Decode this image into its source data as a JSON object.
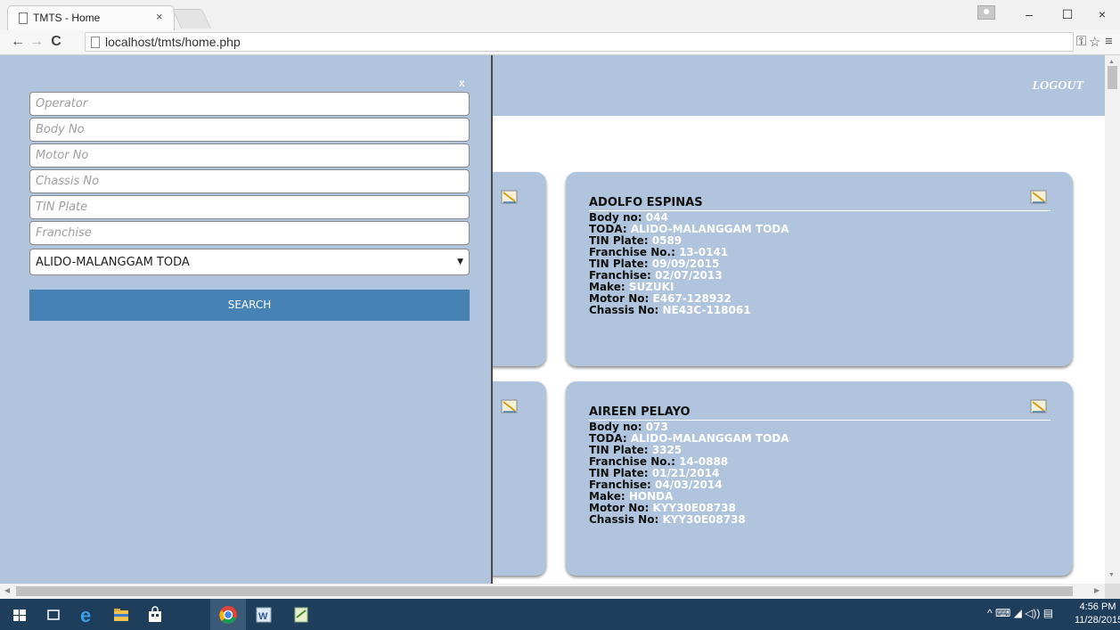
{
  "browser": {
    "tab_title": "TMTS - Home",
    "tab_close": "×",
    "url": "localhost/tmts/home.php",
    "window_controls": {
      "minimize": "–",
      "maximize": "☐",
      "close": "×"
    }
  },
  "header": {
    "logout_label": "LOGOUT"
  },
  "search_panel": {
    "close_label": "x",
    "fields": {
      "operator_placeholder": "Operator",
      "body_no_placeholder": "Body No",
      "motor_no_placeholder": "Motor No",
      "chassis_no_placeholder": "Chassis No",
      "tin_plate_placeholder": "TIN Plate",
      "franchise_placeholder": "Franchise"
    },
    "toda_selected": "ALIDO-MALANGGAM TODA",
    "search_label": "SEARCH"
  },
  "records": [
    {
      "name": "ADOLFO ESPINAS",
      "fields": [
        {
          "label": "Body no:",
          "value": "044"
        },
        {
          "label": "TODA:",
          "value": "ALIDO-MALANGGAM TODA"
        },
        {
          "label": "TIN Plate:",
          "value": "0589"
        },
        {
          "label": "Franchise No.:",
          "value": "13-0141"
        },
        {
          "label": "TIN Plate:",
          "value": "09/09/2015"
        },
        {
          "label": "Franchise:",
          "value": "02/07/2013"
        },
        {
          "label": "Make:",
          "value": "SUZUKI"
        },
        {
          "label": "Motor No:",
          "value": "E467-128932"
        },
        {
          "label": "Chassis No:",
          "value": "NE43C-118061"
        }
      ]
    },
    {
      "name": "AIREEN PELAYO",
      "fields": [
        {
          "label": "Body no:",
          "value": "073"
        },
        {
          "label": "TODA:",
          "value": "ALIDO-MALANGGAM TODA"
        },
        {
          "label": "TIN Plate:",
          "value": "3325"
        },
        {
          "label": "Franchise No.:",
          "value": "14-0888"
        },
        {
          "label": "TIN Plate:",
          "value": "01/21/2014"
        },
        {
          "label": "Franchise:",
          "value": "04/03/2014"
        },
        {
          "label": "Make:",
          "value": "HONDA"
        },
        {
          "label": "Motor No:",
          "value": "KYY30E08738"
        },
        {
          "label": "Chassis No:",
          "value": "KYY30E08738"
        }
      ]
    }
  ],
  "taskbar": {
    "time": "4:56 PM",
    "date": "11/28/2015"
  },
  "colors": {
    "panel_bg": "#b0c4de",
    "search_button": "#4682b4",
    "taskbar": "#1f3e5c"
  }
}
